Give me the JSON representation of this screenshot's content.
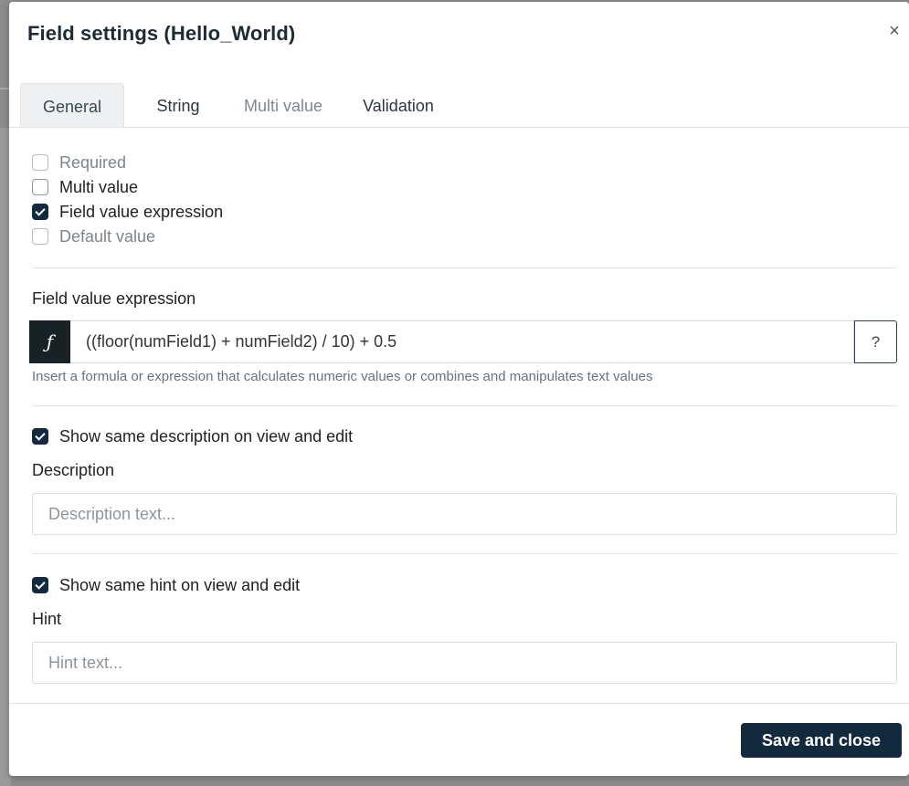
{
  "dialog": {
    "title": "Field settings (Hello_World)",
    "close_icon": "×"
  },
  "tabs": [
    {
      "label": "General",
      "state": "active"
    },
    {
      "label": "String",
      "state": "normal"
    },
    {
      "label": "Multi value",
      "state": "disabled"
    },
    {
      "label": "Validation",
      "state": "normal"
    }
  ],
  "options": [
    {
      "label": "Required",
      "checked": false,
      "enabled": false
    },
    {
      "label": "Multi value",
      "checked": false,
      "enabled": true
    },
    {
      "label": "Field value expression",
      "checked": true,
      "enabled": true
    },
    {
      "label": "Default value",
      "checked": false,
      "enabled": false
    }
  ],
  "expression": {
    "label": "Field value expression",
    "fx_icon": "ƒ",
    "value": "((floor(numField1) + numField2) / 10) + 0.5",
    "help_button": "?",
    "helper_text": "Insert a formula or expression that calculates numeric values or combines and manipulates text values"
  },
  "description": {
    "same_checkbox_label": "Show same description on view and edit",
    "same_checked": true,
    "label": "Description",
    "placeholder": "Description text..."
  },
  "hint": {
    "same_checkbox_label": "Show same hint on view and edit",
    "same_checked": true,
    "label": "Hint",
    "placeholder": "Hint text..."
  },
  "footer": {
    "save_label": "Save and close"
  },
  "colors": {
    "primary": "#13293d",
    "fx_background": "#182225"
  }
}
